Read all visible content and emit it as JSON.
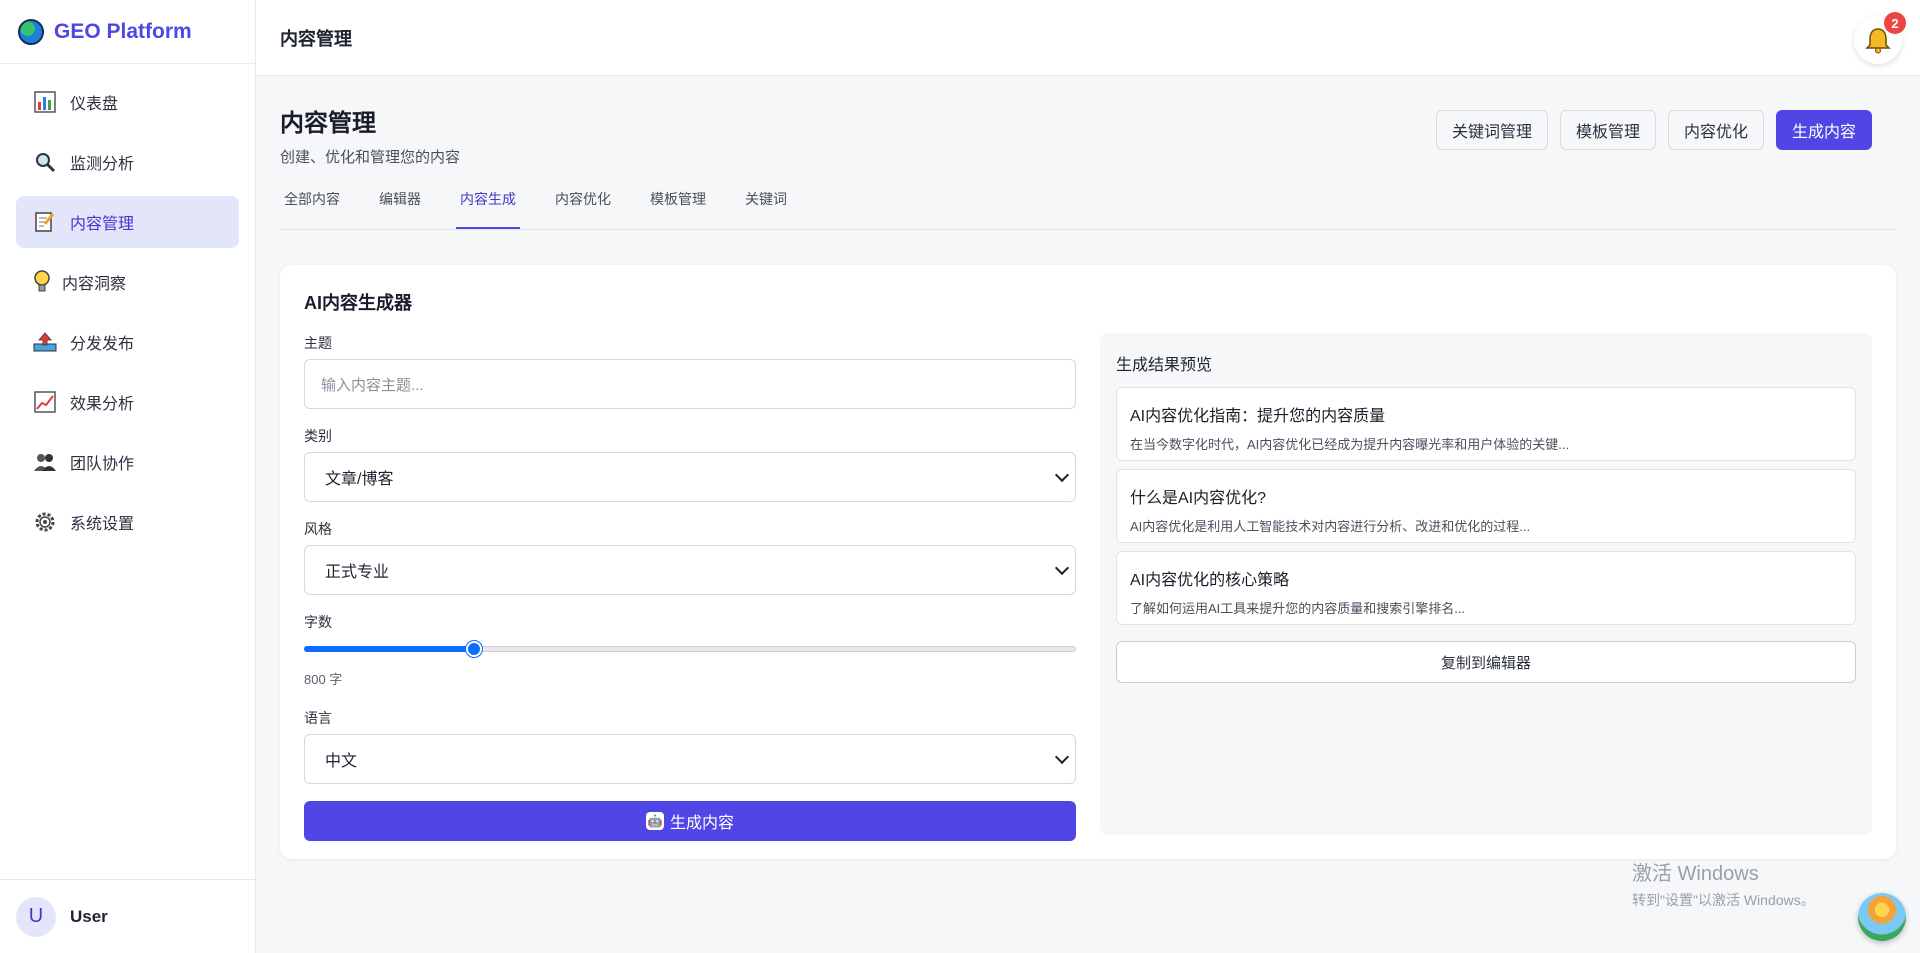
{
  "brand": {
    "name": "GEO Platform"
  },
  "sidebar": {
    "items": [
      {
        "label": "仪表盘",
        "icon": "bar-chart-icon"
      },
      {
        "label": "监测分析",
        "icon": "magnifier-icon"
      },
      {
        "label": "内容管理",
        "icon": "memo-icon"
      },
      {
        "label": "内容洞察",
        "icon": "lightbulb-icon"
      },
      {
        "label": "分发发布",
        "icon": "upload-tray-icon"
      },
      {
        "label": "效果分析",
        "icon": "line-chart-icon"
      },
      {
        "label": "团队协作",
        "icon": "people-icon"
      },
      {
        "label": "系统设置",
        "icon": "gear-icon"
      }
    ],
    "active_index": 2
  },
  "user": {
    "avatar_letter": "U",
    "name": "User"
  },
  "topbar": {
    "title": "内容管理",
    "notification_count": "2"
  },
  "page": {
    "title": "内容管理",
    "subtitle": "创建、优化和管理您的内容"
  },
  "actions": {
    "keywords": "关键词管理",
    "templates": "模板管理",
    "optimize": "内容优化",
    "generate": "生成内容"
  },
  "tabs": [
    "全部内容",
    "编辑器",
    "内容生成",
    "内容优化",
    "模板管理",
    "关键词"
  ],
  "active_tab": 2,
  "generator": {
    "title": "AI内容生成器",
    "topic_label": "主题",
    "topic_placeholder": "输入内容主题...",
    "category_label": "类别",
    "category_value": "文章/博客",
    "style_label": "风格",
    "style_value": "正式专业",
    "words_label": "字数",
    "words_value_text": "800 字",
    "words_fraction": 0.22,
    "language_label": "语言",
    "language_value": "中文",
    "generate_button": "生成内容"
  },
  "preview": {
    "title": "生成结果预览",
    "results": [
      {
        "title": "AI内容优化指南：提升您的内容质量",
        "desc": "在当今数字化时代，AI内容优化已经成为提升内容曝光率和用户体验的关键..."
      },
      {
        "title": "什么是AI内容优化?",
        "desc": "AI内容优化是利用人工智能技术对内容进行分析、改进和优化的过程..."
      },
      {
        "title": "AI内容优化的核心策略",
        "desc": "了解如何运用AI工具来提升您的内容质量和搜索引擎排名..."
      }
    ],
    "copy_button": "复制到编辑器"
  },
  "watermark": {
    "line1": "激活 Windows",
    "line2": "转到\"设置\"以激活 Windows。"
  }
}
